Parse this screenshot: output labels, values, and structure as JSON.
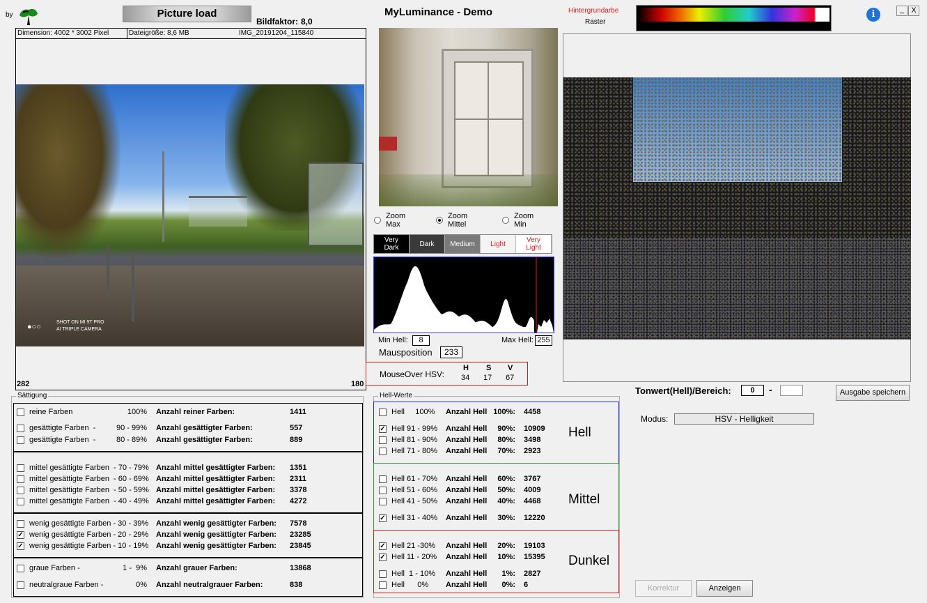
{
  "header": {
    "by": "by",
    "picture_load": "Picture load",
    "bildfaktor_label": "Bildfaktor:",
    "bildfaktor_value": "8,0",
    "title": "MyLuminance - Demo",
    "bg_color_label": "Hintergrundarbe",
    "raster_label": "Raster",
    "minimize": "_",
    "close": "X",
    "info": "i"
  },
  "info_bar": {
    "dimension": "Dimension: 4002 * 3002 Pixel",
    "size": "Dateigröße: 8,6 MB",
    "filename": "IMG_20191204_115840"
  },
  "image_corners": {
    "left": "282",
    "right": "180"
  },
  "watermark": {
    "line1": "SHOT ON MI 9T PRO",
    "line2": "AI TRIPLE CAMERA"
  },
  "zoom": [
    {
      "label": "Zoom\nMax",
      "selected": false
    },
    {
      "label": "Zoom\nMittel",
      "selected": true
    },
    {
      "label": "Zoom\nMin",
      "selected": false
    }
  ],
  "tone_bar": [
    {
      "label": "Very\nDark",
      "bg": "#000000",
      "fg": "#ffffff"
    },
    {
      "label": "Dark",
      "bg": "#3a3a3a",
      "fg": "#ffffff"
    },
    {
      "label": "Medium",
      "bg": "#7a7a7a",
      "fg": "#ffffff"
    },
    {
      "label": "Light",
      "bg": "#f4f4f4",
      "fg": "#e11b1b"
    },
    {
      "label": "Very\nLight",
      "bg": "#ffffff",
      "fg": "#e11b1b"
    }
  ],
  "histogram": {
    "min_label": "Min Hell:",
    "min_value": "8",
    "max_label": "Max Hell:",
    "max_value": "255"
  },
  "mouse": {
    "label": "Mausposition",
    "value": "233",
    "hsv_label": "MouseOver HSV:",
    "h_label": "H",
    "s_label": "S",
    "v_label": "V",
    "h": "34",
    "s": "17",
    "v": "67"
  },
  "saettigung": {
    "legend": "Sättigung",
    "rows": [
      {
        "g": 0,
        "checked": false,
        "label": "reine Farben",
        "range": "100%",
        "count_label": "Anzahl reiner Farben:",
        "count": "1411"
      },
      {
        "g": 0,
        "checked": false,
        "label": "gesättigte Farben  -",
        "range": "90 - 99%",
        "count_label": "Anzahl gesättigter Farben:",
        "count": "557"
      },
      {
        "g": 0,
        "checked": false,
        "label": "gesättigte Farben  -",
        "range": "80 - 89%",
        "count_label": "Anzahl gesättigter Farben:",
        "count": "889"
      },
      {
        "g": 1,
        "checked": false,
        "label": "mittel gesättigte Farben  - 70 - 79%",
        "range": "",
        "count_label": "Anzahl mittel gesättigter Farben:",
        "count": "1351"
      },
      {
        "g": 1,
        "checked": false,
        "label": "mittel gesättigte Farben  - 60 - 69%",
        "range": "",
        "count_label": "Anzahl mittel gesättigter Farben:",
        "count": "2311"
      },
      {
        "g": 1,
        "checked": false,
        "label": "mittel gesättigte Farben  - 50 - 59%",
        "range": "",
        "count_label": "Anzahl mittel gesättigter Farben:",
        "count": "3378"
      },
      {
        "g": 1,
        "checked": false,
        "label": "mittel gesättigte Farben  - 40 - 49%",
        "range": "",
        "count_label": "Anzahl mittel gesättigter Farben:",
        "count": "4272"
      },
      {
        "g": 2,
        "checked": false,
        "label": "wenig gesättigte Farben - 30 - 39%",
        "range": "",
        "count_label": "Anzahl wenig gesättigter Farben:",
        "count": "7578"
      },
      {
        "g": 2,
        "checked": true,
        "label": "wenig gesättigte Farben - 20 - 29%",
        "range": "",
        "count_label": "Anzahl wenig gesättigter Farben:",
        "count": "23285"
      },
      {
        "g": 2,
        "checked": true,
        "label": "wenig gesättigte Farben - 10 - 19%",
        "range": "",
        "count_label": "Anzahl wenig gesättigter Farben:",
        "count": "23845"
      },
      {
        "g": 3,
        "checked": false,
        "label": "graue Farben -",
        "range": "1 -  9%",
        "count_label": "Anzahl grauer Farben:",
        "count": "13868"
      },
      {
        "g": 3,
        "checked": false,
        "label": "neutralgraue Farben -",
        "range": "0%",
        "count_label": "Anzahl neutralgrauer Farben:",
        "count": "838"
      }
    ]
  },
  "hell": {
    "legend": "Hell-Werte",
    "groups": [
      {
        "name": "Hell",
        "color": "#1f2bd1"
      },
      {
        "name": "Mittel",
        "color": "#2aa52a"
      },
      {
        "name": "Dunkel",
        "color": "#d01f1f"
      }
    ],
    "rows": [
      {
        "g": 0,
        "checked": false,
        "label": "Hell     100%",
        "count_label": "Anzahl Hell",
        "pct": "100%:",
        "count": "4458"
      },
      {
        "g": 0,
        "checked": true,
        "label": "Hell 91 - 99%",
        "count_label": "Anzahl Hell",
        "pct": "90%:",
        "count": "10909"
      },
      {
        "g": 0,
        "checked": false,
        "label": "Hell 81 - 90%",
        "count_label": "Anzahl Hell",
        "pct": "80%:",
        "count": "3498"
      },
      {
        "g": 0,
        "checked": false,
        "label": "Hell 71 - 80%",
        "count_label": "Anzahl Hell",
        "pct": "70%:",
        "count": "2923"
      },
      {
        "g": 1,
        "checked": false,
        "label": "Hell 61 - 70%",
        "count_label": "Anzahl Hell",
        "pct": "60%:",
        "count": "3767"
      },
      {
        "g": 1,
        "checked": false,
        "label": "Hell 51 - 60%",
        "count_label": "Anzahl Hell",
        "pct": "50%:",
        "count": "4009"
      },
      {
        "g": 1,
        "checked": false,
        "label": "Hell 41 - 50%",
        "count_label": "Anzahl Hell",
        "pct": "40%:",
        "count": "4468"
      },
      {
        "g": 1,
        "checked": true,
        "label": "Hell 31 - 40%",
        "count_label": "Anzahl Hell",
        "pct": "30%:",
        "count": "12220"
      },
      {
        "g": 2,
        "checked": true,
        "label": "Hell 21 -30%",
        "count_label": "Anzahl Hell",
        "pct": "20%:",
        "count": "19103"
      },
      {
        "g": 2,
        "checked": true,
        "label": "Hell 11 - 20%",
        "count_label": "Anzahl Hell",
        "pct": "10%:",
        "count": "15395"
      },
      {
        "g": 2,
        "checked": false,
        "label": "Hell  1 - 10%",
        "count_label": "Anzahl Hell",
        "pct": "1%:",
        "count": "2827"
      },
      {
        "g": 2,
        "checked": false,
        "label": "Hell      0%",
        "count_label": "Anzahl Hell",
        "pct": "0%:",
        "count": "6"
      }
    ]
  },
  "tonwert": {
    "label": "Tonwert(Hell)/Bereich:",
    "from": "0",
    "dash": "-",
    "to": "",
    "save": "Ausgabe speichern"
  },
  "modus": {
    "label": "Modus:",
    "value": "HSV - Helligkeit"
  },
  "buttons": {
    "korrektur": "Korrektur",
    "anzeigen": "Anzeigen"
  },
  "colors": {
    "blue": "#1f2bd1",
    "green": "#2aa52a",
    "red": "#d01f1f"
  }
}
